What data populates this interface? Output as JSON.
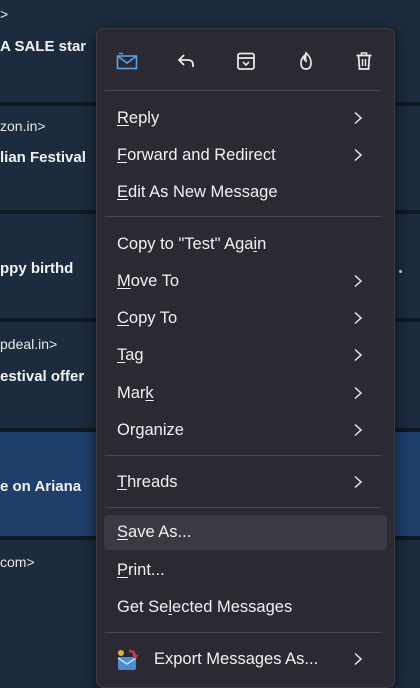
{
  "background_list": {
    "rows": [
      {
        "sender": ">",
        "subject": "A SALE star"
      },
      {
        "sender": "zon.in>",
        "subject": "lian Festival"
      },
      {
        "sender": "",
        "subject": "ppy birthd"
      },
      {
        "sender": "pdeal.in>",
        "subject": "estival offer"
      },
      {
        "sender": "",
        "subject": "e on Ariana"
      },
      {
        "sender": "com>",
        "subject": ""
      }
    ]
  },
  "toolbar": {
    "buttons": [
      {
        "name": "new-message-icon"
      },
      {
        "name": "reply-icon"
      },
      {
        "name": "archive-icon"
      },
      {
        "name": "junk-icon"
      },
      {
        "name": "delete-icon"
      }
    ]
  },
  "menu": {
    "reply": {
      "pre": "",
      "u": "R",
      "post": "eply"
    },
    "forward": {
      "pre": "",
      "u": "F",
      "post": "orward and Redirect"
    },
    "edit_new": {
      "pre": "",
      "u": "E",
      "post": "dit As New Message"
    },
    "copy_to_test": {
      "pre": "Copy to \"Test\" Aga",
      "u": "i",
      "post": "n"
    },
    "move_to": {
      "pre": "",
      "u": "M",
      "post": "ove To"
    },
    "copy_to": {
      "pre": "",
      "u": "C",
      "post": "opy To"
    },
    "tag": {
      "pre": "",
      "u": "T",
      "post": "ag"
    },
    "mark": {
      "pre": "Mar",
      "u": "k",
      "post": ""
    },
    "organize": {
      "pre": "Organize",
      "u": "",
      "post": ""
    },
    "threads": {
      "pre": "",
      "u": "T",
      "post": "hreads"
    },
    "save_as": {
      "pre": "",
      "u": "S",
      "post": "ave As..."
    },
    "print": {
      "pre": "",
      "u": "P",
      "post": "rint..."
    },
    "get_selected": {
      "pre": "Get Se",
      "u": "l",
      "post": "ected Messages"
    },
    "export": {
      "pre": "Export Messages As...",
      "u": "",
      "post": ""
    }
  },
  "colors": {
    "menu_bg": "#2b2a33",
    "hover_bg": "#3b3a43",
    "accent": "#5aa0e6",
    "list_bg": "#1c2b3d",
    "selected_row": "#1f3f6b"
  }
}
